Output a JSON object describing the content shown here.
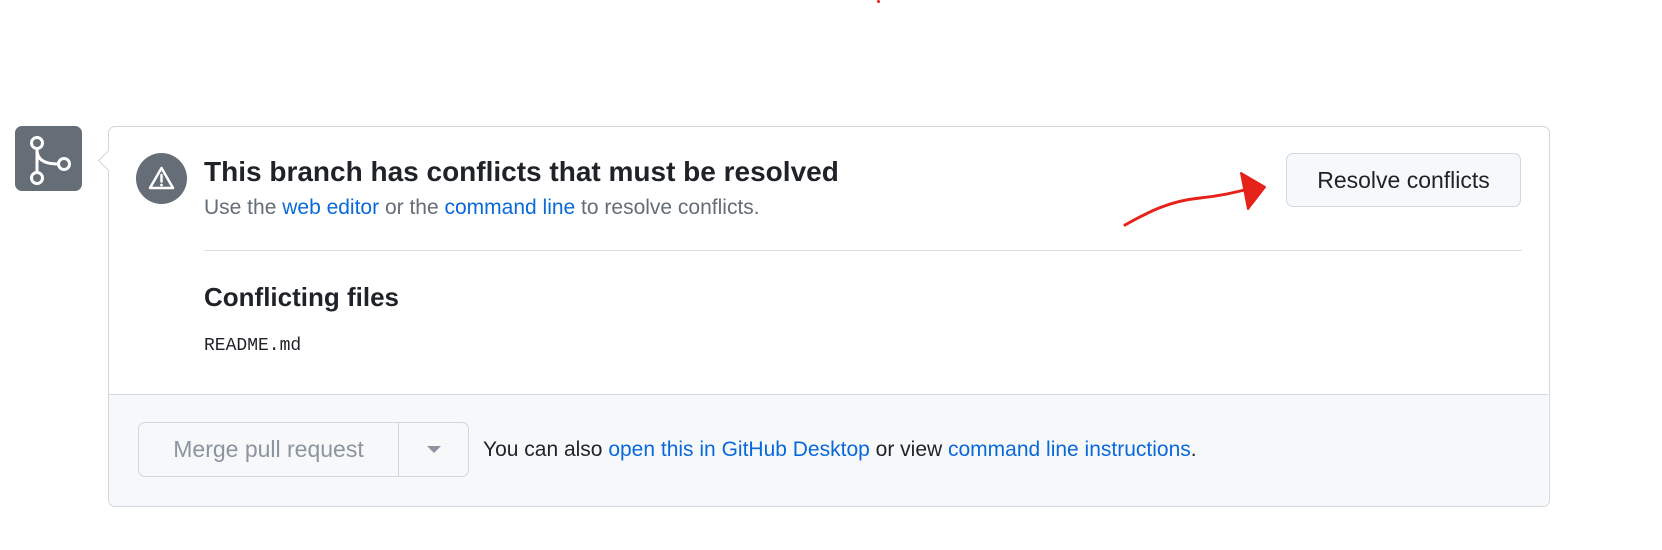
{
  "alert": {
    "title": "This branch has conflicts that must be resolved",
    "subtitle_prefix": "Use the ",
    "web_editor_link": "web editor",
    "subtitle_middle": " or the ",
    "command_line_link": "command line",
    "subtitle_suffix": " to resolve conflicts.",
    "icon": "alert-triangle-icon"
  },
  "resolve_button": {
    "label": "Resolve conflicts"
  },
  "conflicting": {
    "heading": "Conflicting files",
    "files": [
      "README.md"
    ]
  },
  "merge": {
    "button_label": "Merge pull request",
    "dropdown_icon": "caret-down-icon",
    "footer_prefix": "You can also ",
    "desktop_link": "open this in GitHub Desktop",
    "footer_middle": " or view ",
    "instructions_link": "command line instructions",
    "footer_suffix": "."
  },
  "side_icon": "git-merge-icon",
  "colors": {
    "link": "#0969da",
    "icon_bg": "#656d76",
    "border": "#d0d7de",
    "footer_bg": "#f6f8fa",
    "annotation": "#e5231b",
    "disabled_text": "#8c959f"
  }
}
